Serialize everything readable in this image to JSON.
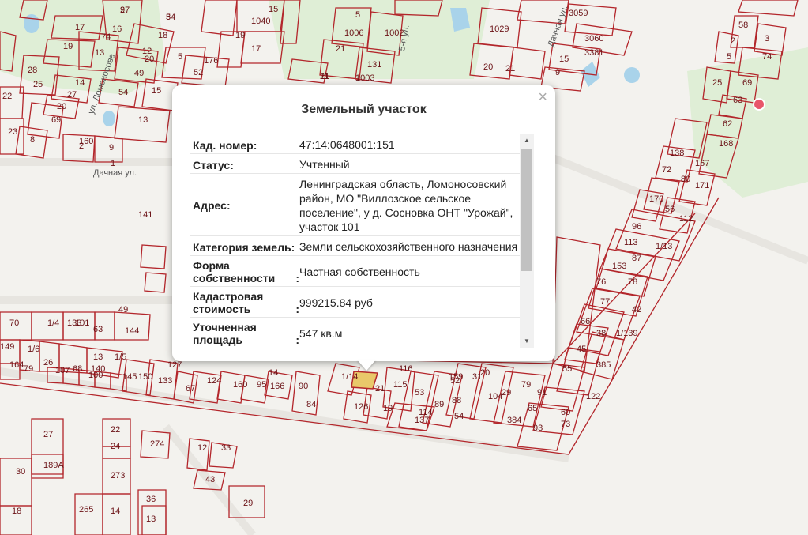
{
  "map": {
    "streets": [
      "ул. Ломоносова",
      "Дачная ул.",
      "Дачная ул.",
      "5-я ул.",
      "Дачная ул."
    ],
    "parcel_labels": [
      "9",
      "3",
      "16",
      "17",
      "19",
      "74",
      "13",
      "18",
      "20",
      "12",
      "49",
      "5",
      "15",
      "52",
      "176",
      "28",
      "25",
      "14",
      "27",
      "20",
      "69",
      "54",
      "13",
      "23",
      "8",
      "2",
      "160",
      "9",
      "1",
      "22",
      "1040",
      "15",
      "17",
      "19",
      "1006",
      "5",
      "1002",
      "21",
      "131",
      "1003",
      "21",
      "11",
      "3059",
      "1029",
      "3060",
      "3381",
      "20",
      "15",
      "9",
      "21",
      "58",
      "2",
      "3",
      "5",
      "74",
      "25",
      "69",
      "63",
      "62",
      "168",
      "138",
      "167",
      "72",
      "80",
      "171",
      "170",
      "56",
      "112",
      "96",
      "113",
      "1/13",
      "87",
      "153",
      "78",
      "76",
      "77",
      "42",
      "66",
      "1/139",
      "38",
      "45",
      "385",
      "55",
      "122",
      "73",
      "65",
      "93",
      "60",
      "91",
      "79",
      "104",
      "20",
      "384",
      "52",
      "31",
      "29",
      "159",
      "88",
      "89",
      "54",
      "137",
      "116",
      "115",
      "53",
      "114",
      "21",
      "19",
      "126",
      "1/14",
      "14",
      "166",
      "90",
      "84",
      "95",
      "160",
      "124",
      "67",
      "133",
      "127",
      "150",
      "145",
      "100",
      "140",
      "68",
      "13",
      "1/5",
      "70",
      "1/4",
      "133",
      "101",
      "63",
      "144",
      "49",
      "1/6",
      "149",
      "164",
      "79",
      "26",
      "107",
      "141",
      "27",
      "189A",
      "22",
      "24",
      "273",
      "274",
      "30",
      "36",
      "14",
      "265",
      "12",
      "33",
      "43",
      "29",
      "18",
      "13",
      "27",
      "54"
    ]
  },
  "popup": {
    "title": "Земельный участок",
    "close_symbol": "×",
    "rows": [
      {
        "key": "Кад. номер",
        "value": "47:14:0648001:151"
      },
      {
        "key": "Статус",
        "value": "Учтенный"
      },
      {
        "key": "Адрес",
        "value": "Ленинградская область, Ломоносовский район, МО \"Виллозское сельское поселение\", у д. Сосновка ОНТ \"Урожай\", участок 101"
      },
      {
        "key": "Категория земель",
        "value": "Земли сельскохозяйственного назначения"
      },
      {
        "key": "Форма собственности",
        "value": "Частная собственность"
      },
      {
        "key": "Кадастровая стоимость",
        "value": "999215.84 руб"
      },
      {
        "key": "Уточненная площадь",
        "value": "547 кв.м"
      }
    ]
  },
  "colors": {
    "parcel": "#b3262b",
    "green": "#d9ead0",
    "water": "#a9d3ea",
    "highlight": "#e9c86a"
  }
}
